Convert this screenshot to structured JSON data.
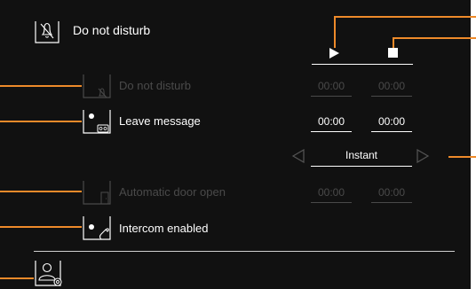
{
  "header": {
    "title": "Do not disturb",
    "icon": "bell-off-icon"
  },
  "controls": {
    "start_icon": "play-icon",
    "stop_icon": "stop-icon"
  },
  "options": [
    {
      "label": "Do not disturb",
      "enabled": false,
      "icon": "bell-off-icon",
      "start": "00:00",
      "end": "00:00"
    },
    {
      "label": "Leave message",
      "enabled": true,
      "icon": "voicemail-icon",
      "start": "00:00",
      "end": "00:00"
    },
    {
      "label": "Automatic door open",
      "enabled": false,
      "icon": "door-icon",
      "start": "00:00",
      "end": "00:00"
    },
    {
      "label": "Intercom enabled",
      "enabled": true,
      "icon": "handset-icon"
    }
  ],
  "selector": {
    "value": "Instant"
  },
  "footer": {
    "settings_icon": "user-settings-icon"
  },
  "colors": {
    "background": "#111111",
    "text": "#ffffff",
    "disabled": "#4a4a4a",
    "callout": "#ee8a2a"
  }
}
